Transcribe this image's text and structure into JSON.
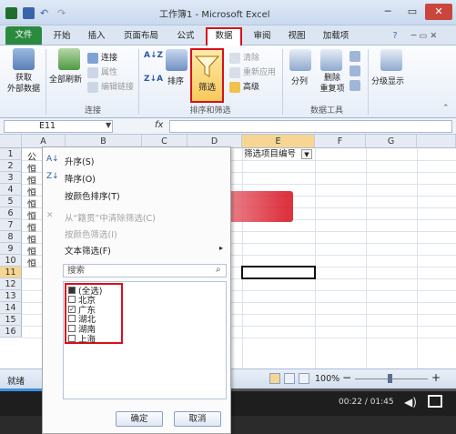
{
  "window": {
    "title": "工作簿1 - Microsoft Excel",
    "min": "─",
    "max": "▭",
    "close": "✕"
  },
  "ribbon_tabs": [
    "文件",
    "开始",
    "插入",
    "页面布局",
    "公式",
    "数据",
    "审阅",
    "视图",
    "加载项"
  ],
  "ribbon": {
    "get_external": "获取\n外部数据",
    "get_external_1": "获取",
    "get_external_2": "外部数据",
    "refresh_all": "全部刷新",
    "connections": "连接",
    "properties": "属性",
    "edit_links": "编辑链接",
    "group_connections": "连接",
    "sort_az": "A↓Z",
    "sort_za": "Z↓A",
    "sort": "排序",
    "filter": "筛选",
    "clear": "清除",
    "reapply": "重新应用",
    "advanced": "高级",
    "group_sort_filter": "排序和筛选",
    "text_to_columns": "分列",
    "remove_duplicates": "删除\n重复项",
    "remove_dup_1": "删除",
    "remove_dup_2": "重复项",
    "group_data_tools": "数据工具",
    "outline": "分级显示"
  },
  "formula_bar": {
    "name_box": "E11",
    "fx": "fx",
    "value": ""
  },
  "columns": [
    "A",
    "B",
    "C",
    "D",
    "E",
    "F",
    "G"
  ],
  "rows": [
    "1",
    "2",
    "3",
    "4",
    "5",
    "6",
    "7",
    "8",
    "9",
    "10",
    "11",
    "12",
    "13",
    "14",
    "15",
    "16"
  ],
  "cells": {
    "A1": "公",
    "A2": "恒",
    "A3": "恒",
    "A4": "恒",
    "A5": "恒",
    "A6": "恒",
    "A7": "恒",
    "A8": "恒",
    "A9": "恒",
    "A10": "恒",
    "E1": "筛选项目编号"
  },
  "filter_menu": {
    "sort_asc": "升序(S)",
    "sort_desc": "降序(O)",
    "sort_color": "按颜色排序(T)",
    "clear_filter": "从“籍贯”中清除筛选(C)",
    "filter_color": "按颜色筛选(I)",
    "text_filter": "文本筛选(F)",
    "search_placeholder": "搜索",
    "items": [
      {
        "label": "(全选)",
        "state": "partial"
      },
      {
        "label": "北京",
        "state": "unchecked"
      },
      {
        "label": "广东",
        "state": "checked"
      },
      {
        "label": "湖北",
        "state": "unchecked"
      },
      {
        "label": "湖南",
        "state": "unchecked"
      },
      {
        "label": "上海",
        "state": "unchecked"
      }
    ],
    "ok": "确定",
    "cancel": "取消"
  },
  "status": {
    "ready": "就绪",
    "zoom": "100%",
    "zoom_minus": "−",
    "zoom_plus": "+"
  },
  "video": {
    "time": "00:22 / 01:45"
  },
  "colors": {
    "accent_red": "#d7101e",
    "file_tab": "#2a8a40"
  }
}
